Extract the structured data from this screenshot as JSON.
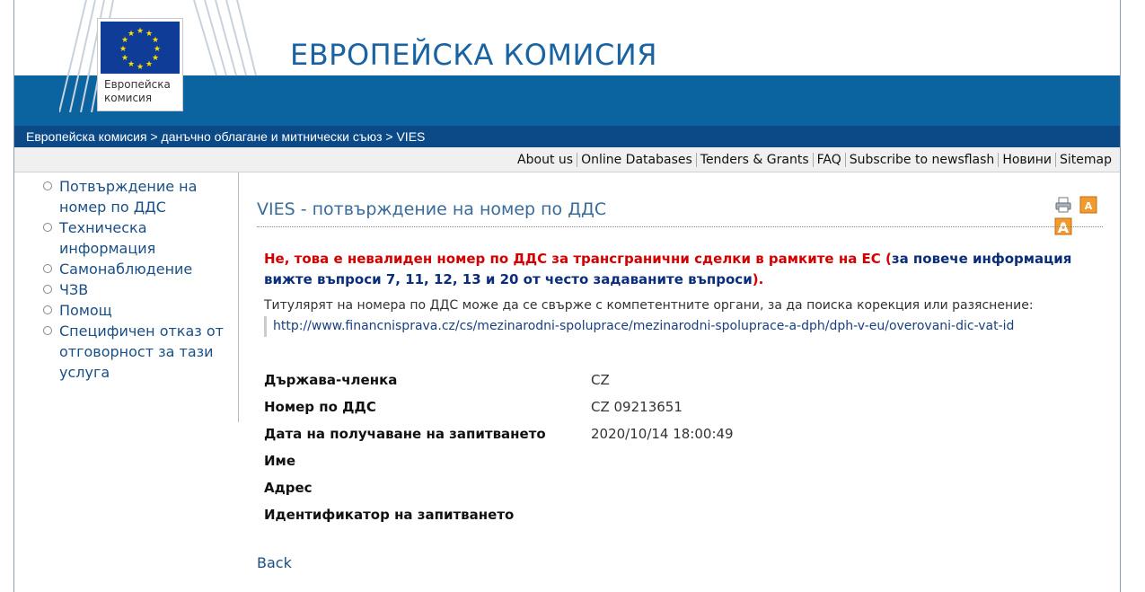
{
  "header": {
    "site_title": "ЕВРОПЕЙСКА КОМИСИЯ",
    "logo_text_line1": "Европейска",
    "logo_text_line2": "комисия"
  },
  "breadcrumb": {
    "item1": "Европейска комисия",
    "item2": "данъчно облагане и митнически съюз",
    "item3": "VIES",
    "separator": ">"
  },
  "topnav": {
    "items": [
      "About us",
      "Online Databases",
      "Tenders & Grants",
      "FAQ",
      "Subscribe to newsflash",
      "Новини",
      "Sitemap"
    ]
  },
  "sidebar": {
    "items": [
      "Потвърждение на номер по ДДС",
      "Техническа информация",
      "Самонаблюдение",
      "ЧЗВ",
      "Помощ",
      "Специфичен отказ от отговорност за тази услуга"
    ]
  },
  "main": {
    "title": "VIES - потвърждение на номер по ДДС",
    "error_red": "Не, това е невалиден номер по ДДС за трансгранични сделки в рамките на ЕС (",
    "error_blue": "за повече информация вижте въпроси 7, 11, 12, 13 и 20 от често задаваните въпроси",
    "error_tail": ").",
    "info_text": "Титулярят на номера по ДДС може да се свърже с компетентните органи, за да поиска корекция или разяснение:",
    "info_url": "http://www.financnisprava.cz/cs/mezinarodni-spoluprace/mezinarodni-spoluprace-a-dph/dph-v-eu/overovani-dic-vat-id",
    "details": {
      "member_state_label": "Държава-членка",
      "member_state_value": "CZ",
      "vat_label": "Номер по ДДС",
      "vat_value": "CZ 09213651",
      "date_label": "Дата на получаване на запитването",
      "date_value": "2020/10/14 18:00:49",
      "name_label": "Име",
      "address_label": "Адрес",
      "request_id_label": "Идентификатор на запитването"
    },
    "back_label": "Back"
  },
  "icons": {
    "print": "print-icon",
    "font_smaller": "font-smaller-icon",
    "font_larger": "font-larger-icon"
  },
  "colors": {
    "header_band": "#0b64a0",
    "breadcrumb_bg": "#0b4a86",
    "error_red": "#d40000",
    "error_blue": "#0b2e7a",
    "link_blue": "#1a4f86",
    "title_blue": "#1a63a3"
  }
}
